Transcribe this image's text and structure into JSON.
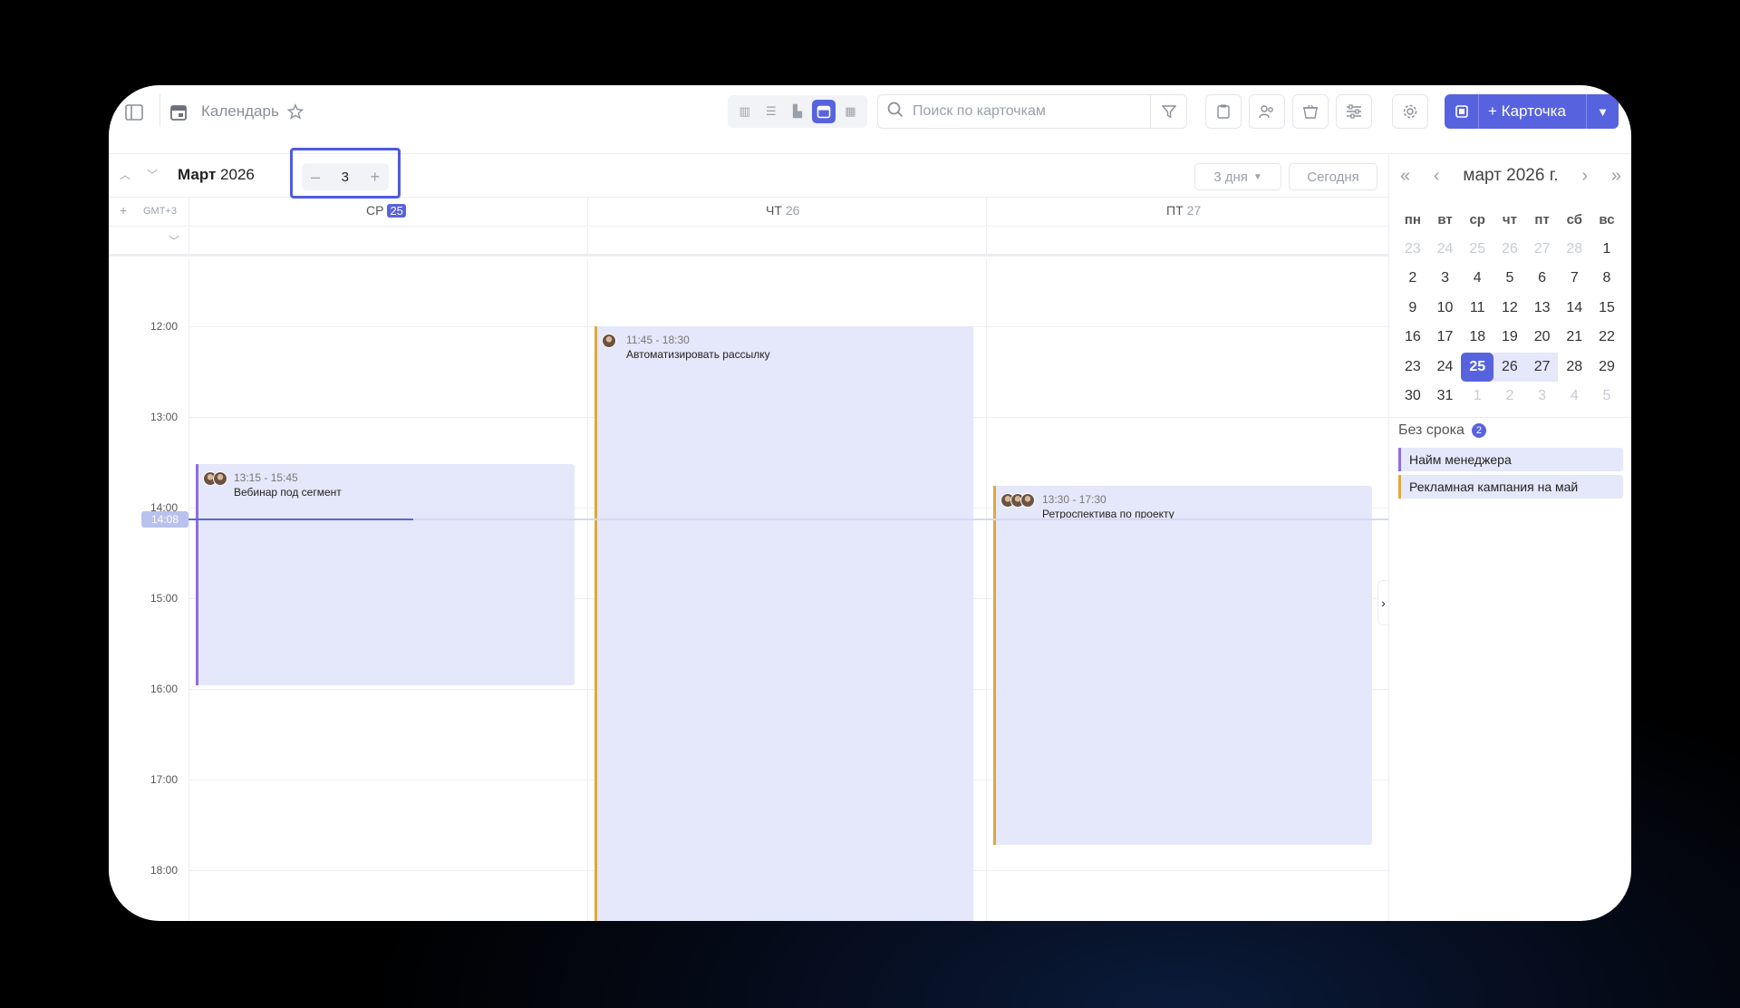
{
  "colors": {
    "accent": "#5763de",
    "event_bg": "#e5e7fa",
    "bar_purple": "#8b6fe0",
    "bar_orange": "#e0a83a"
  },
  "header": {
    "title": "Календарь",
    "search_placeholder": "Поиск по карточкам",
    "add_label": "Карточка"
  },
  "nav": {
    "month": "Март",
    "year": "2026",
    "days_count": "3",
    "range_label": "3 дня",
    "today_label": "Сегодня"
  },
  "grid": {
    "timezone": "GMT+3",
    "days": [
      {
        "dow": "СР",
        "num": "25"
      },
      {
        "dow": "ЧТ",
        "num": "26"
      },
      {
        "dow": "ПТ",
        "num": "27"
      }
    ],
    "hours": [
      "12:00",
      "13:00",
      "14:00",
      "15:00",
      "16:00",
      "17:00",
      "18:00"
    ],
    "now_label": "14:08"
  },
  "events": [
    {
      "time": "13:15 - 15:45",
      "title": "Вебинар под сегмент",
      "day": "СР 25",
      "bar": "purple"
    },
    {
      "time": "11:45 - 18:30",
      "title": "Автоматизировать рассылку",
      "day": "ЧТ 26",
      "bar": "orange"
    },
    {
      "time": "13:30 - 17:30",
      "title": "Ретроспектива по проекту",
      "day": "ПТ 27",
      "bar": "orange"
    }
  ],
  "mini_calendar": {
    "title": "март 2026 г.",
    "weekdays": [
      "пн",
      "вт",
      "ср",
      "чт",
      "пт",
      "сб",
      "вс"
    ],
    "weeks": [
      [
        "23",
        "24",
        "25",
        "26",
        "27",
        "28",
        "1"
      ],
      [
        "2",
        "3",
        "4",
        "5",
        "6",
        "7",
        "8"
      ],
      [
        "9",
        "10",
        "11",
        "12",
        "13",
        "14",
        "15"
      ],
      [
        "16",
        "17",
        "18",
        "19",
        "20",
        "21",
        "22"
      ],
      [
        "23",
        "24",
        "25",
        "26",
        "27",
        "28",
        "29"
      ],
      [
        "30",
        "31",
        "1",
        "2",
        "3",
        "4",
        "5"
      ]
    ]
  },
  "no_deadline": {
    "label": "Без срока",
    "count": "2",
    "items": [
      {
        "title": "Найм менеджера",
        "bar": "purple"
      },
      {
        "title": "Рекламная кампания на май",
        "bar": "orange"
      }
    ]
  }
}
